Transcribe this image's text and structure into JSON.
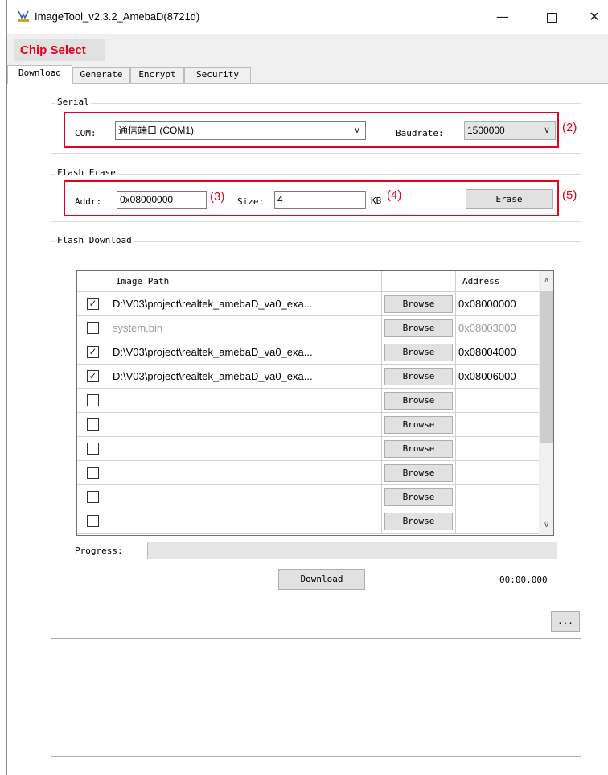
{
  "window": {
    "title": "ImageTool_v2.3.2_AmebaD(8721d)",
    "minimize_glyph": "—",
    "close_glyph": "✕"
  },
  "chip_select": {
    "label": "Chip Select"
  },
  "tabs": [
    {
      "label": "Download",
      "active": true
    },
    {
      "label": "Generate",
      "active": false
    },
    {
      "label": "Encrypt",
      "active": false
    },
    {
      "label": "Security",
      "active": false
    }
  ],
  "serial": {
    "group_label": "Serial",
    "com_label": "COM:",
    "com_value": "通信端口 (COM1)",
    "baudrate_label": "Baudrate:",
    "baudrate_value": "1500000",
    "annotation": "(2)"
  },
  "flash_erase": {
    "group_label": "Flash Erase",
    "addr_label": "Addr:",
    "addr_value": "0x08000000",
    "addr_annotation": "(3)",
    "size_label": "Size:",
    "size_value": "4",
    "size_unit": "KB",
    "size_annotation": "(4)",
    "erase_button": "Erase",
    "erase_annotation": "(5)"
  },
  "flash_download": {
    "group_label": "Flash Download",
    "columns": [
      "Image Path",
      "Address"
    ],
    "rows": [
      {
        "checked": true,
        "path": "D:\\V03\\project\\realtek_amebaD_va0_exa...",
        "browse": "Browse",
        "address": "0x08000000",
        "dim": false
      },
      {
        "checked": false,
        "path": "system.bin",
        "browse": "Browse",
        "address": "0x08003000",
        "dim": true
      },
      {
        "checked": true,
        "path": "D:\\V03\\project\\realtek_amebaD_va0_exa...",
        "browse": "Browse",
        "address": "0x08004000",
        "dim": false
      },
      {
        "checked": true,
        "path": "D:\\V03\\project\\realtek_amebaD_va0_exa...",
        "browse": "Browse",
        "address": "0x08006000",
        "dim": false
      },
      {
        "checked": false,
        "path": "",
        "browse": "Browse",
        "address": "",
        "dim": false
      },
      {
        "checked": false,
        "path": "",
        "browse": "Browse",
        "address": "",
        "dim": false
      },
      {
        "checked": false,
        "path": "",
        "browse": "Browse",
        "address": "",
        "dim": false
      },
      {
        "checked": false,
        "path": "",
        "browse": "Browse",
        "address": "",
        "dim": false
      },
      {
        "checked": false,
        "path": "",
        "browse": "Browse",
        "address": "",
        "dim": false
      },
      {
        "checked": false,
        "path": "",
        "browse": "Browse",
        "address": "",
        "dim": false
      }
    ],
    "progress_label": "Progress:",
    "progress_value": 0,
    "download_button": "Download",
    "elapsed_time": "00:00.000"
  },
  "more_button": "...",
  "colors": {
    "annotation_red": "#e8001c",
    "chip_select_red": "#e8001c"
  }
}
